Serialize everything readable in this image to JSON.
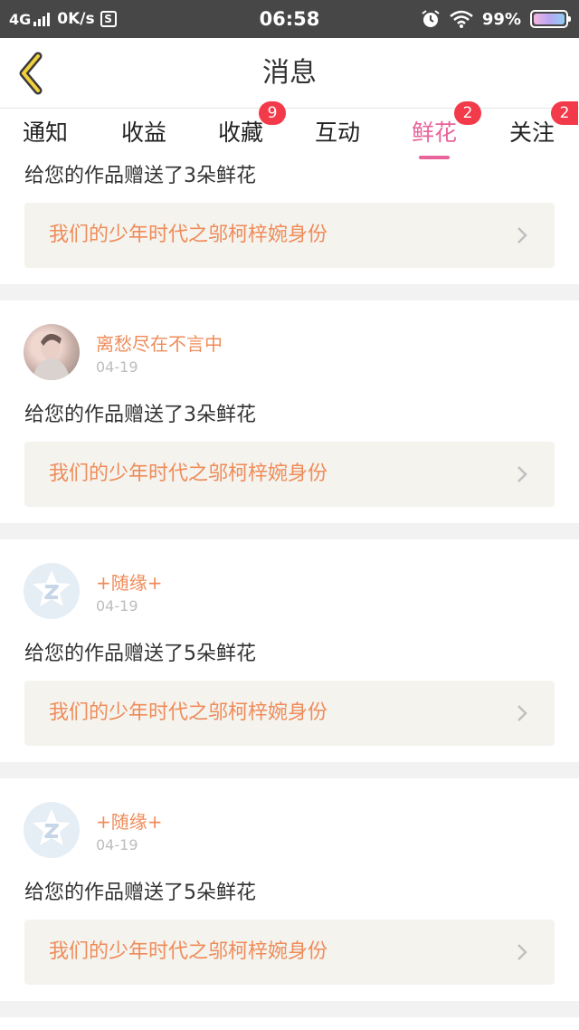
{
  "status_bar": {
    "network": "4G",
    "speed": "0K/s",
    "s_icon": "S",
    "time": "06:58",
    "battery": "99%",
    "icons": [
      "signal-icon",
      "s-app-icon",
      "alarm-icon",
      "wifi-icon",
      "battery-icon"
    ]
  },
  "header": {
    "title": "消息",
    "back_icon": "chevron-left-icon"
  },
  "tabs": [
    {
      "label": "通知",
      "badge": null
    },
    {
      "label": "收益",
      "badge": null
    },
    {
      "label": "收藏",
      "badge": "9"
    },
    {
      "label": "互动",
      "badge": null
    },
    {
      "label": "鲜花",
      "badge": "2",
      "active": true
    },
    {
      "label": "关注",
      "badge": "2"
    }
  ],
  "colors": {
    "accent": "#e8649a",
    "name_color": "#ef8c5a",
    "badge": "#f23a4a",
    "link_bg": "#f4f3ee"
  },
  "messages": [
    {
      "message": "给您的作品赠送了3朵鲜花",
      "work": "我们的少年时代之邬柯梓婉身份"
    },
    {
      "user": "离愁尽在不言中",
      "date": "04-19",
      "message": "给您的作品赠送了3朵鲜花",
      "work": "我们的少年时代之邬柯梓婉身份"
    },
    {
      "user": "+随缘+",
      "date": "04-19",
      "message": "给您的作品赠送了5朵鲜花",
      "work": "我们的少年时代之邬柯梓婉身份"
    },
    {
      "user": "+随缘+",
      "date": "04-19",
      "message": "给您的作品赠送了5朵鲜花",
      "work": "我们的少年时代之邬柯梓婉身份"
    }
  ]
}
